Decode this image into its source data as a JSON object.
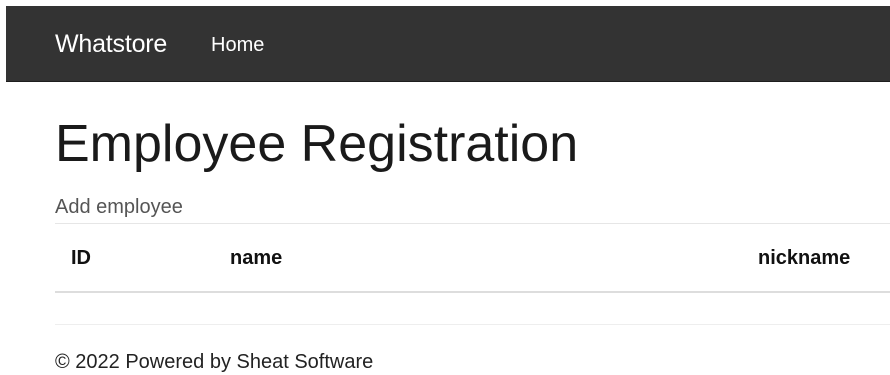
{
  "navbar": {
    "brand": "Whatstore",
    "links": [
      {
        "label": "Home"
      }
    ]
  },
  "main": {
    "title": "Employee Registration",
    "add_link": "Add employee",
    "table": {
      "columns": [
        "ID",
        "name",
        "nickname"
      ],
      "rows": []
    }
  },
  "footer": {
    "text": "© 2022 Powered by Sheat Software"
  },
  "colors": {
    "navbar_bg": "#333333",
    "navbar_text": "#ffffff",
    "link_muted": "#555555"
  }
}
